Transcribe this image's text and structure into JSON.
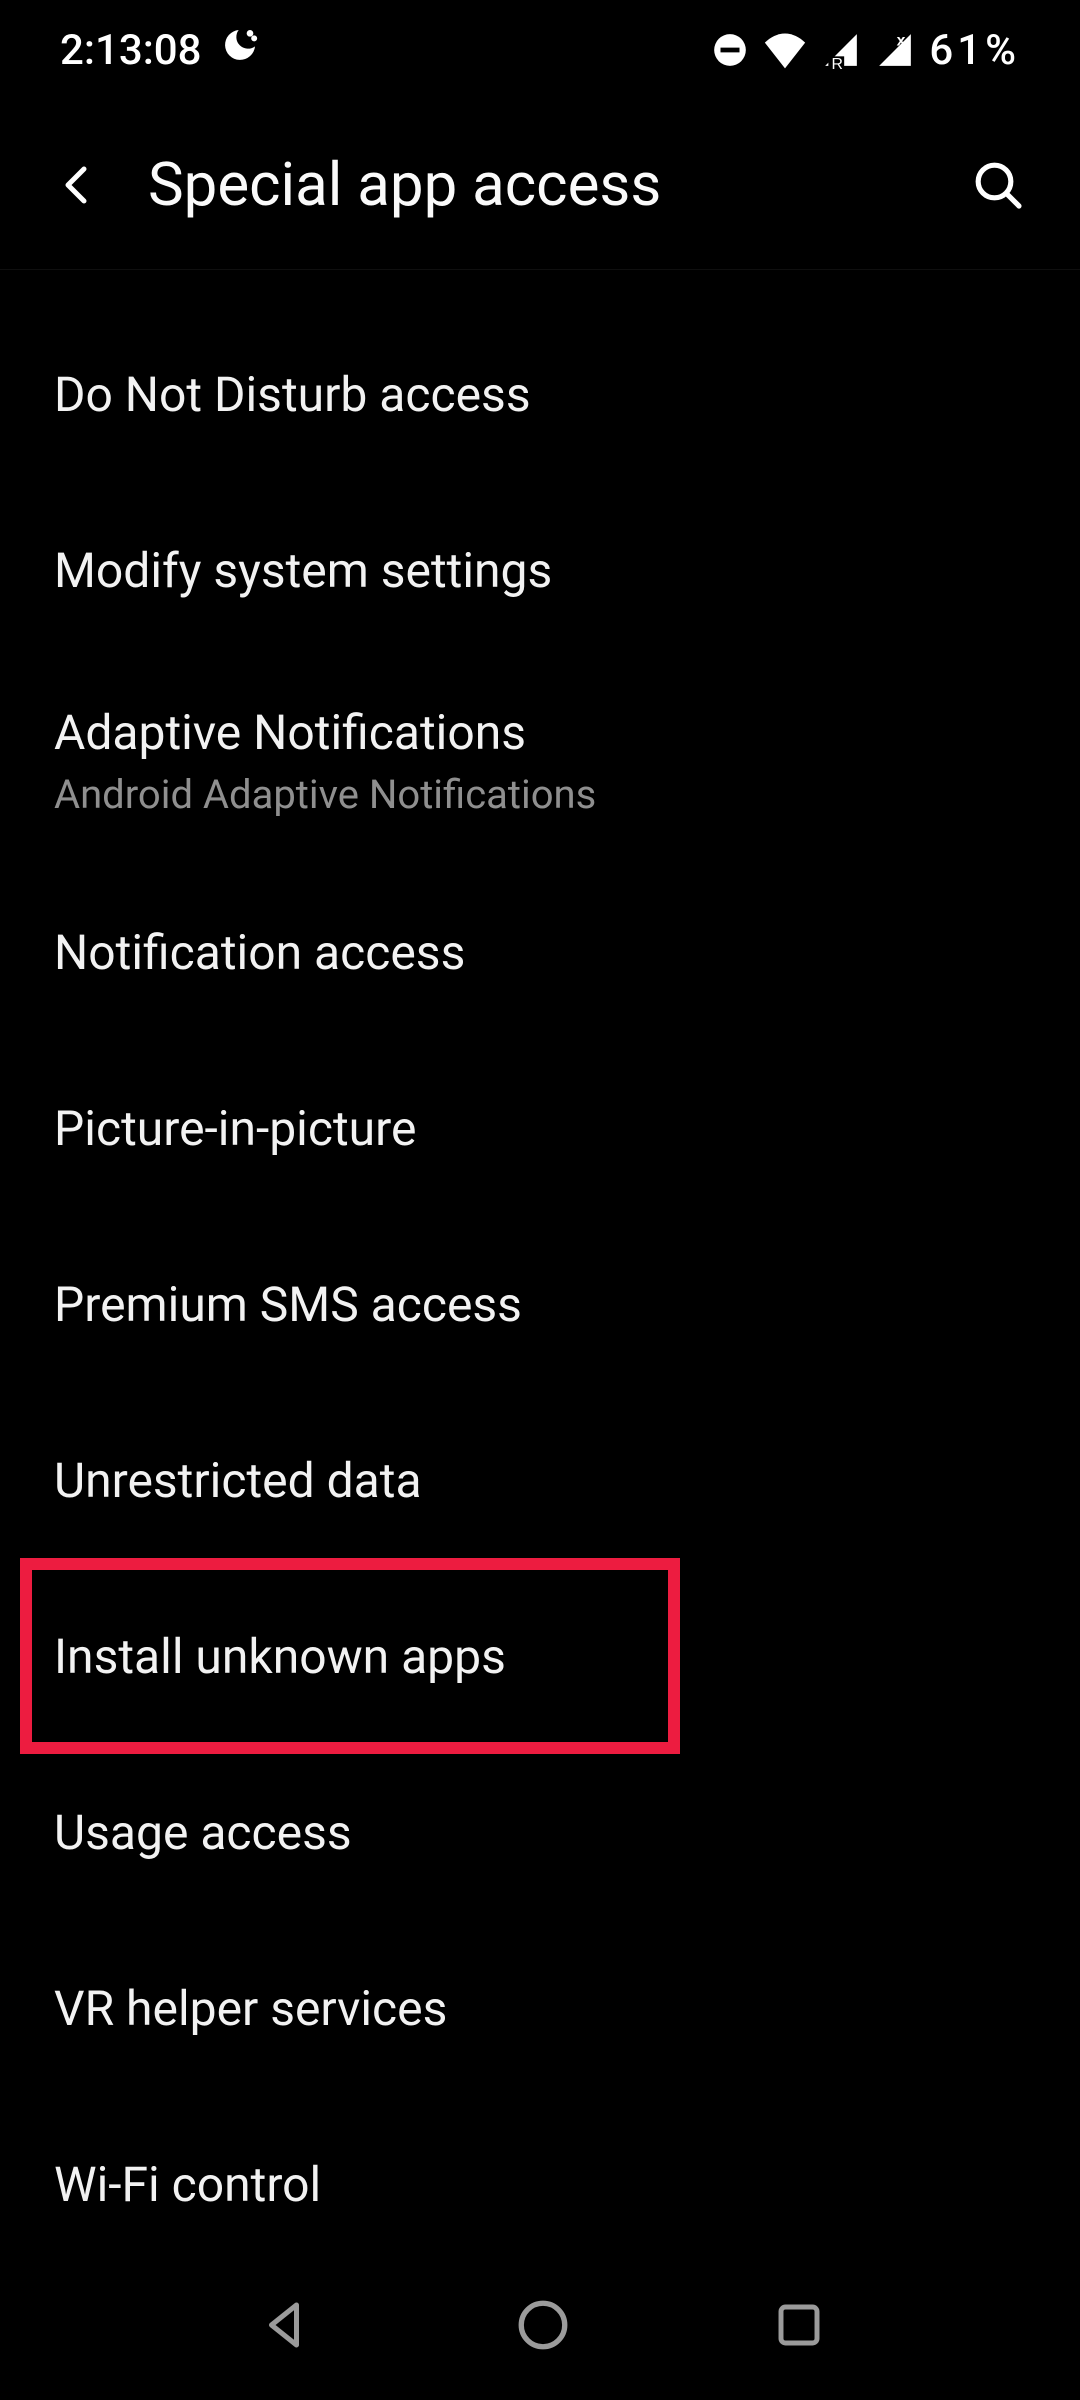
{
  "status": {
    "time": "2:13:08",
    "battery": "61%"
  },
  "header": {
    "title": "Special app access"
  },
  "items": [
    {
      "label": "Do Not Disturb access"
    },
    {
      "label": "Modify system settings"
    },
    {
      "label": "Adaptive Notifications",
      "sub": "Android Adaptive Notifications"
    },
    {
      "label": "Notification access"
    },
    {
      "label": "Picture-in-picture"
    },
    {
      "label": "Premium SMS access"
    },
    {
      "label": "Unrestricted data"
    },
    {
      "label": "Install unknown apps"
    },
    {
      "label": "Usage access"
    },
    {
      "label": "VR helper services"
    },
    {
      "label": "Wi-Fi control"
    }
  ]
}
